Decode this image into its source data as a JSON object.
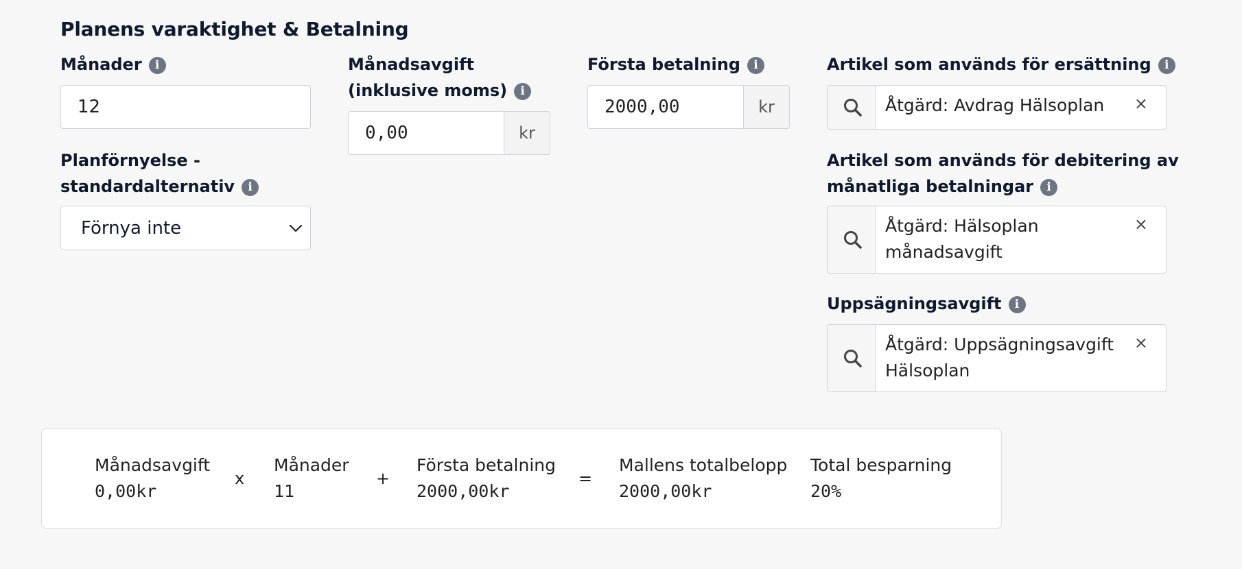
{
  "section_title": "Planens varaktighet & Betalning",
  "months": {
    "label": "Månader",
    "value": "12"
  },
  "renewal": {
    "label_line1": "Planförnyelse -",
    "label_line2": "standardalternativ",
    "selected": "Förnya inte"
  },
  "monthly_fee": {
    "label_line1": "Månadsavgift",
    "label_line2": "(inklusive moms)",
    "value": "0,00",
    "unit": "kr"
  },
  "first_payment": {
    "label": "Första betalning",
    "value": "2000,00",
    "unit": "kr"
  },
  "refund_article": {
    "label": "Artikel som används för ersättning",
    "value": "Åtgärd: Avdrag Hälsoplan"
  },
  "monthly_debit_article": {
    "label_line1": "Artikel som används för debitering av",
    "label_line2": "månatliga betalningar",
    "value_line1": "Åtgärd: Hälsoplan",
    "value_line2": "månadsavgift"
  },
  "cancellation_fee": {
    "label": "Uppsägningsavgift",
    "value_line1": "Åtgärd: Uppsägningsavgift",
    "value_line2": "Hälsoplan"
  },
  "info_glyph": "i",
  "clear_glyph": "×",
  "summary": {
    "monthly_fee_label": "Månadsavgift",
    "monthly_fee_value": "0,00kr",
    "times": "x",
    "months_label": "Månader",
    "months_value": "11",
    "plus": "+",
    "first_payment_label": "Första betalning",
    "first_payment_value": "2000,00kr",
    "equals": "=",
    "total_label": "Mallens totalbelopp",
    "total_value": "2000,00kr",
    "savings_label": "Total besparning",
    "savings_value": "20%"
  },
  "icons": [
    "info-icon",
    "search-icon",
    "clear-icon",
    "chevron-down-icon"
  ],
  "colors": {
    "text": "#0f1a2e",
    "info_badge": "#6d7583",
    "border": "#cfd4da",
    "background": "#f7f7f7"
  }
}
